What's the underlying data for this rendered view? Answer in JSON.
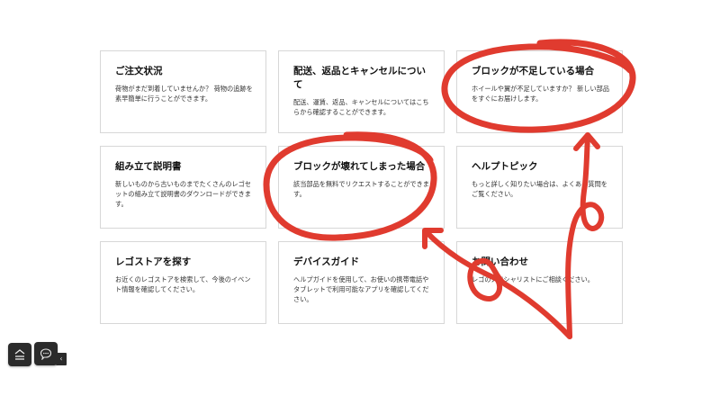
{
  "cards": [
    {
      "title": "ご注文状況",
      "desc": "荷物がまだ到着していませんか？ 荷物の追跡を素早簡単に行うことができます。"
    },
    {
      "title": "配送、返品とキャンセルについて",
      "desc": "配送、運賃、返品、キャンセルについてはこちらから確認することができます。"
    },
    {
      "title": "ブロックが不足している場合",
      "desc": "ホイールや翼が不足していますか？ 新しい部品をすぐにお届けします。"
    },
    {
      "title": "組み立て説明書",
      "desc": "新しいものから古いものまでたくさんのレゴセットの組み立て説明書のダウンロードができます。"
    },
    {
      "title": "ブロックが壊れてしまった場合",
      "desc": "該当部品を無料でリクエストすることができます。"
    },
    {
      "title": "ヘルプトピック",
      "desc": "もっと詳しく知りたい場合は、よくある質問をご覧ください。"
    },
    {
      "title": "レゴストアを探す",
      "desc": "お近くのレゴストアを検索して、今後のイベント情報を確認してください。"
    },
    {
      "title": "デバイスガイド",
      "desc": "ヘルプガイドを使用して、お使いの携帯電話やタブレットで利用可能なアプリを確認してください。"
    },
    {
      "title": "お問い合わせ",
      "desc": "レゴのスペシャリストにご相談ください。"
    }
  ],
  "widgets": {
    "collapse_glyph": "‹"
  },
  "colors": {
    "annotation_red": "#e03b2f",
    "fab_bg": "#2b2b2b",
    "card_border": "#d7d7d7"
  },
  "icons": [
    "menu-icon",
    "chat-icon",
    "chevron-left-icon"
  ]
}
